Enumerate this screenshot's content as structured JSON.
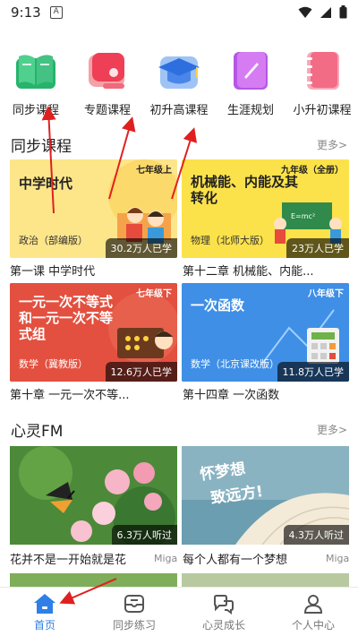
{
  "status": {
    "time": "9:13",
    "notif_glyph": "A"
  },
  "categories": [
    {
      "label": "同步课程",
      "icon": "green-book-icon"
    },
    {
      "label": "专题课程",
      "icon": "red-tag-icon"
    },
    {
      "label": "初升高课程",
      "icon": "graduation-cap-icon"
    },
    {
      "label": "生涯规划",
      "icon": "purple-notebook-icon"
    },
    {
      "label": "小升初课程",
      "icon": "pink-notebook-icon"
    }
  ],
  "sync_section": {
    "title": "同步课程",
    "more": "更多>"
  },
  "courses": [
    {
      "grade": "七年级上",
      "title": "中学时代",
      "subject": "政治（部编版）",
      "learners": "30.2万人已学",
      "caption": "第一课 中学时代"
    },
    {
      "grade": "九年级（全册）",
      "title": "机械能、内能及其转化",
      "subject": "物理（北师大版）",
      "learners": "23万人已学",
      "caption": "第十二章 机械能、内能..."
    },
    {
      "grade": "七年级下",
      "title": "一元一次不等式和一元一次不等式组",
      "subject": "数学（冀教版）",
      "learners": "12.6万人已学",
      "caption": "第十章 一元一次不等..."
    },
    {
      "grade": "八年级下",
      "title": "一次函数",
      "subject": "数学（北京课改版）",
      "learners": "11.8万人已学",
      "caption": "第十四章 一次函数"
    }
  ],
  "fm_section": {
    "title": "心灵FM",
    "more": "更多>"
  },
  "fm_items": [
    {
      "listens": "6.3万人听过",
      "caption": "花并不是一开始就是花",
      "author": "Miga"
    },
    {
      "listens": "4.3万人听过",
      "caption": "每个人都有一个梦想",
      "author": "Miga",
      "image_text_1": "怀梦想",
      "image_text_2": "致远方!"
    }
  ],
  "nav": [
    {
      "label": "首页",
      "icon": "home-icon",
      "active": true
    },
    {
      "label": "同步练习",
      "icon": "practice-icon",
      "active": false
    },
    {
      "label": "心灵成长",
      "icon": "growth-icon",
      "active": false
    },
    {
      "label": "个人中心",
      "icon": "person-icon",
      "active": false
    }
  ],
  "colors": {
    "accent": "#2f7fe6",
    "card_yellow": "#fde58a",
    "card_red": "#e3503f",
    "card_blue": "#3f8fe6"
  }
}
